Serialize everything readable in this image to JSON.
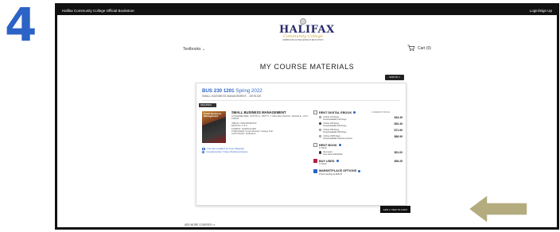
{
  "step_number": "4",
  "topbar": {
    "store_name": "Halifax Community College Official Bookstore",
    "login_label": "Login/Sign Up"
  },
  "logo": {
    "text": "HALIFAX",
    "subtext": "Community College",
    "tagline": "EMBRACING EXCELLENCE IN EDUCATION"
  },
  "nav": {
    "textbooks_label": "Textbooks",
    "cart_label": "Cart (0)"
  },
  "page_title": "MY COURSE MATERIALS",
  "sort_label": "SORT BY",
  "course": {
    "code": "BUS 230 1201",
    "term": "Spring 2022",
    "name": "SMALL BUSINESS MANAGEMENT - 20HS125"
  },
  "required_tag": "REQUIRED",
  "book": {
    "cover_title": "Small Business Management",
    "title": "SMALL BUSINESS MANAGEMENT",
    "authors": "LONGENECKER, JUSTIN G., PETTY, J. WILLIAM, PALICH, LESLIE E., HOY, FRANK",
    "isbn": "ISBN13: 9781305405752",
    "edition": "EDITION: 17TH",
    "format": "FORMAT: HARDCOVER",
    "publisher": "PUBLISHER: South-Western College Pub.",
    "copyright": "COPYRIGHT: 6/28/2012"
  },
  "links": {
    "free_shipping": "This item qualifies for Free Shipping!",
    "complimentary": "Complimentary 7-Day eTextbook Access"
  },
  "current_price_label": "CURRENT PRICE",
  "digital": {
    "heading": "RENT DIGITAL EBOOK",
    "options": [
      {
        "label": "Online 120 Days",
        "sub": "Downloadable 120 Days",
        "price": "$43.49"
      },
      {
        "label": "Online 180 Days",
        "sub": "Downloadable 180 Days",
        "price": "$52.49"
      },
      {
        "label": "Online 365 Days",
        "sub": "Downloadable 365 Days",
        "price": "$71.99"
      },
      {
        "label": "Online 1825 Days",
        "sub": "Downloadable Lifetime Access",
        "price": "$86.99"
      }
    ]
  },
  "rent": {
    "heading": "RENT BOOK",
    "stock": "In Stock",
    "option_label": "Semester",
    "due": "Due back 5/20/2022",
    "price": "$51.00"
  },
  "used": {
    "heading": "BUY USED",
    "stock": "In Stock",
    "price": "$59.25"
  },
  "marketplace": {
    "heading": "MARKETPLACE OPTIONS",
    "sub": "Prices starting at $28.25"
  },
  "add_button_label": "ADD 1 ITEM TO CART",
  "add_more_label": "ADD MORE COURSES >>",
  "colors": {
    "accent_blue": "#2b63c6",
    "arrow_fill": "#b4ac7e"
  }
}
